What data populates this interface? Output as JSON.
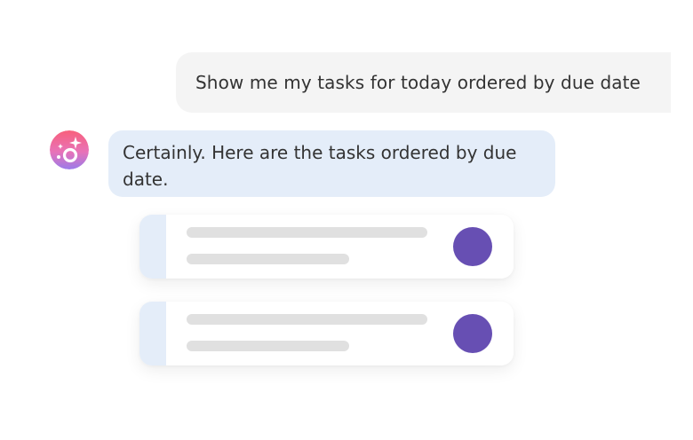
{
  "conversation": {
    "user_message": "Show me my tasks for today ordered by due date",
    "assistant_message": "Certainly. Here are the tasks ordered by due date."
  },
  "avatar": {
    "icon": "sparkle-ring-icon",
    "gradient_top": "#f5607a",
    "gradient_bottom": "#9b7bea"
  },
  "task_cards": [
    {
      "placeholder": true
    },
    {
      "placeholder": true
    }
  ],
  "colors": {
    "user_bubble": "#f4f4f4",
    "assistant_bubble": "#e4edf9",
    "task_status_dot": "#674fb3",
    "skeleton": "#e0e0e0"
  }
}
